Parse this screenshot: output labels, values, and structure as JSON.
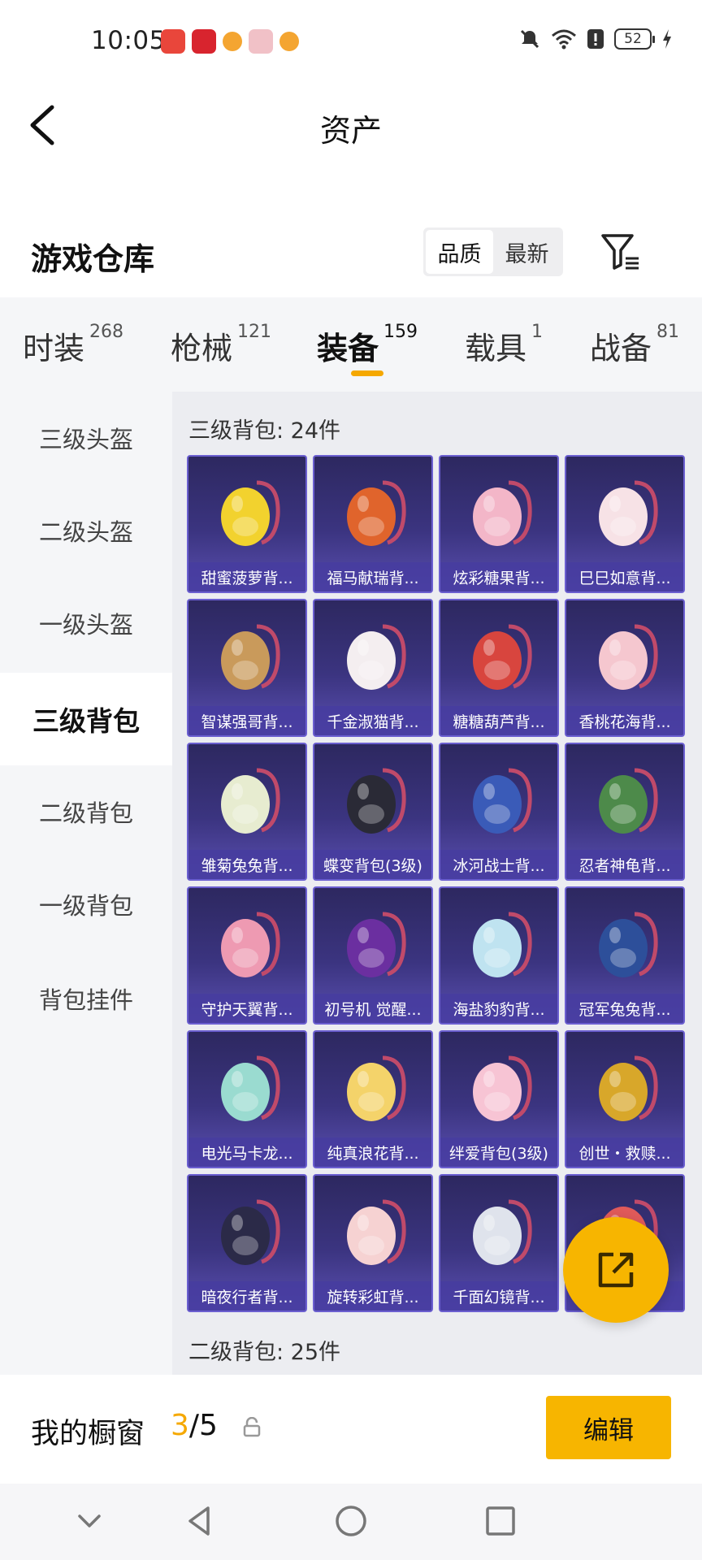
{
  "status_bar": {
    "time": "10:05",
    "battery": "52",
    "notification_icons": [
      "huawei-app-icon",
      "gift-app-icon",
      "game-app-icon",
      "cake-app-icon",
      "game-app-icon-2"
    ],
    "system_icons": [
      "mute-icon",
      "wifi-icon",
      "alert-icon",
      "battery-icon",
      "charging-icon"
    ]
  },
  "header": {
    "title": "资产"
  },
  "warehouse": {
    "title": "游戏仓库",
    "sort_options": [
      "品质",
      "最新"
    ],
    "active_sort": "品质"
  },
  "category_tabs": [
    {
      "label": "时装",
      "count": "268"
    },
    {
      "label": "枪械",
      "count": "121"
    },
    {
      "label": "装备",
      "count": "159",
      "active": true
    },
    {
      "label": "载具",
      "count": "1"
    },
    {
      "label": "战备",
      "count": "81"
    }
  ],
  "sidebar": {
    "items": [
      "三级头盔",
      "二级头盔",
      "一级头盔",
      "三级背包",
      "二级背包",
      "一级背包",
      "背包挂件"
    ],
    "active": "三级背包"
  },
  "sections": [
    {
      "title": "三级背包: 24件",
      "items": [
        {
          "name": "甜蜜菠萝背...",
          "color": "#f2d22e"
        },
        {
          "name": "福马献瑞背...",
          "color": "#e0642c"
        },
        {
          "name": "炫彩糖果背...",
          "color": "#f3b6c8"
        },
        {
          "name": "巳巳如意背...",
          "color": "#f7e2e6"
        },
        {
          "name": "智谋强哥背...",
          "color": "#c99a5b"
        },
        {
          "name": "千金淑猫背...",
          "color": "#f4eef0"
        },
        {
          "name": "糖糖葫芦背...",
          "color": "#d8453e"
        },
        {
          "name": "香桃花海背...",
          "color": "#f5c7cf"
        },
        {
          "name": "雏菊兔兔背...",
          "color": "#e7ecd0"
        },
        {
          "name": "蝶变背包(3级)",
          "color": "#2a2a36"
        },
        {
          "name": "冰河战士背...",
          "color": "#3a5bb8"
        },
        {
          "name": "忍者神龟背...",
          "color": "#4d8a4a"
        },
        {
          "name": "守护天翼背...",
          "color": "#ee9ab2"
        },
        {
          "name": "初号机 觉醒...",
          "color": "#6b2fa0"
        },
        {
          "name": "海盐豹豹背...",
          "color": "#bfe3f0"
        },
        {
          "name": "冠军兔兔背...",
          "color": "#2d4f9a"
        },
        {
          "name": "电光马卡龙...",
          "color": "#9adbd0"
        },
        {
          "name": "纯真浪花背...",
          "color": "#f4d36a"
        },
        {
          "name": "绊爱背包(3级)",
          "color": "#f7c4d4"
        },
        {
          "name": "创世・救赎...",
          "color": "#d8a72a"
        },
        {
          "name": "暗夜行者背...",
          "color": "#2b2a48"
        },
        {
          "name": "旋转彩虹背...",
          "color": "#f6d2d2"
        },
        {
          "name": "千面幻镜背...",
          "color": "#dfe3ec"
        },
        {
          "name": "",
          "color": "#e05a5a"
        }
      ]
    },
    {
      "title": "二级背包: 25件"
    }
  ],
  "window_bar": {
    "label": "我的橱窗",
    "current": "3",
    "total": "/5",
    "edit_label": "编辑"
  },
  "nav_bar": {
    "buttons": [
      "chevron-down-icon",
      "back-triangle-icon",
      "home-circle-icon",
      "recents-square-icon"
    ]
  },
  "colors": {
    "accent": "#f7b500",
    "card_bg": "#3b3480"
  }
}
